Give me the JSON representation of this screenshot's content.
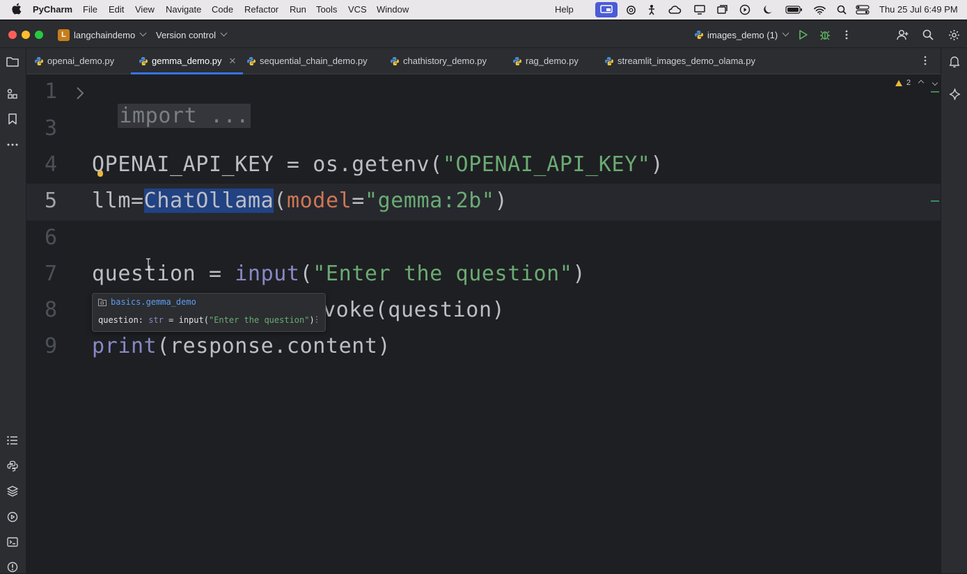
{
  "menubar": {
    "app_name": "PyCharm",
    "items": [
      "File",
      "Edit",
      "View",
      "Navigate",
      "Code",
      "Refactor",
      "Run",
      "Tools",
      "VCS",
      "Window",
      "Help"
    ],
    "clock": "Thu 25 Jul  6:49 PM"
  },
  "titlebar": {
    "project_badge": "L",
    "project_name": "langchaindemo",
    "vcs": "Version control",
    "run_config": "images_demo (1)"
  },
  "tabs": [
    {
      "label": "openai_demo.py",
      "active": false
    },
    {
      "label": "gemma_demo.py",
      "active": true
    },
    {
      "label": "sequential_chain_demo.py",
      "active": false
    },
    {
      "label": "chathistory_demo.py",
      "active": false
    },
    {
      "label": "rag_demo.py",
      "active": false
    },
    {
      "label": "streamlit_images_demo_olama.py",
      "active": false
    }
  ],
  "inspection": {
    "warning_count": "2"
  },
  "editor": {
    "lines": [
      {
        "num": "1",
        "text": "import ..."
      },
      {
        "num": "3",
        "text": ""
      },
      {
        "num": "4",
        "text": "OPENAI_API_KEY = os.getenv(\"OPENAI_API_KEY\")"
      },
      {
        "num": "5",
        "text": "llm=ChatOllama(model=\"gemma:2b\")"
      },
      {
        "num": "6",
        "text": ""
      },
      {
        "num": "7",
        "text": "question = input(\"Enter the question\")"
      },
      {
        "num": "8",
        "text": "voke(question)"
      },
      {
        "num": "9",
        "text": "print(response.content)"
      }
    ],
    "tokens": {
      "l4_var": "OPENAI_API_KEY = os.getenv(",
      "l4_str": "\"OPENAI_API_KEY\"",
      "l4_end": ")",
      "l5_a": "llm=",
      "l5_sel": "ChatOllama",
      "l5_b": "(",
      "l5_param": "model",
      "l5_c": "=",
      "l5_str": "\"gemma:2b\"",
      "l5_d": ")",
      "l7_a": "question = ",
      "l7_fn": "input",
      "l7_b": "(",
      "l7_str": "\"Enter the question\"",
      "l7_c": ")",
      "l8": "voke(question)",
      "l9_fn": "print",
      "l9_rest": "(response.content)"
    }
  },
  "popup": {
    "module": "basics.gemma_demo",
    "sig_name": "question: ",
    "sig_type": "str",
    "sig_eq": " = input(",
    "sig_str": "\"Enter the question\"",
    "sig_end": ")"
  },
  "colors": {
    "accent": "#3574f0",
    "string": "#6aab73",
    "parameter": "#cf7654",
    "builtin": "#8888c6",
    "selection": "#214283"
  }
}
